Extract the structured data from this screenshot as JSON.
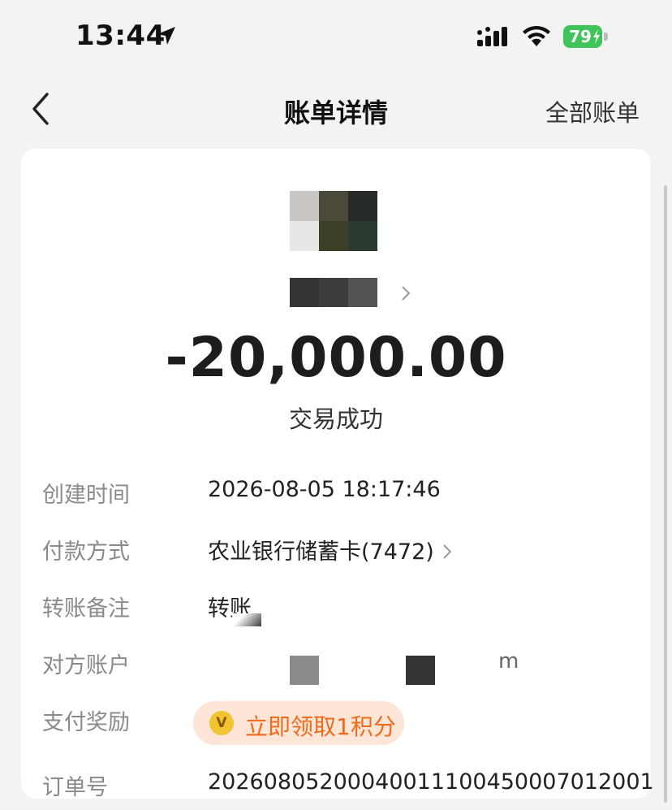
{
  "status_bar": {
    "time": "13:44",
    "battery": "79",
    "icons": [
      "location-arrow-icon",
      "signal-icon",
      "wifi-icon",
      "battery-icon"
    ]
  },
  "nav": {
    "title": "账单详情",
    "right_link": "全部账单",
    "back_icon": "chevron-left-icon"
  },
  "transaction": {
    "amount": "-20,000.00",
    "status": "交易成功"
  },
  "details": [
    {
      "label": "创建时间",
      "value": "2026-08-05 18:17:46"
    },
    {
      "label": "付款方式",
      "value": "农业银行储蓄卡(7472)"
    },
    {
      "label": "转账备注",
      "value": "转账"
    },
    {
      "label": "对方账户",
      "value": "m"
    },
    {
      "label": "支付奖励",
      "value": ""
    },
    {
      "label": "订单号",
      "value": "20260805200040011100450007012001"
    }
  ],
  "reward": {
    "text": "立即领取1积分",
    "icon": "v-coin-icon",
    "icon_text": "V"
  },
  "colors": {
    "amount": "#1d1d1d",
    "label": "#8a8a8a",
    "reward_bg": "#fde6d7",
    "reward_text": "#f06a1c",
    "battery": "#3ec45a"
  }
}
